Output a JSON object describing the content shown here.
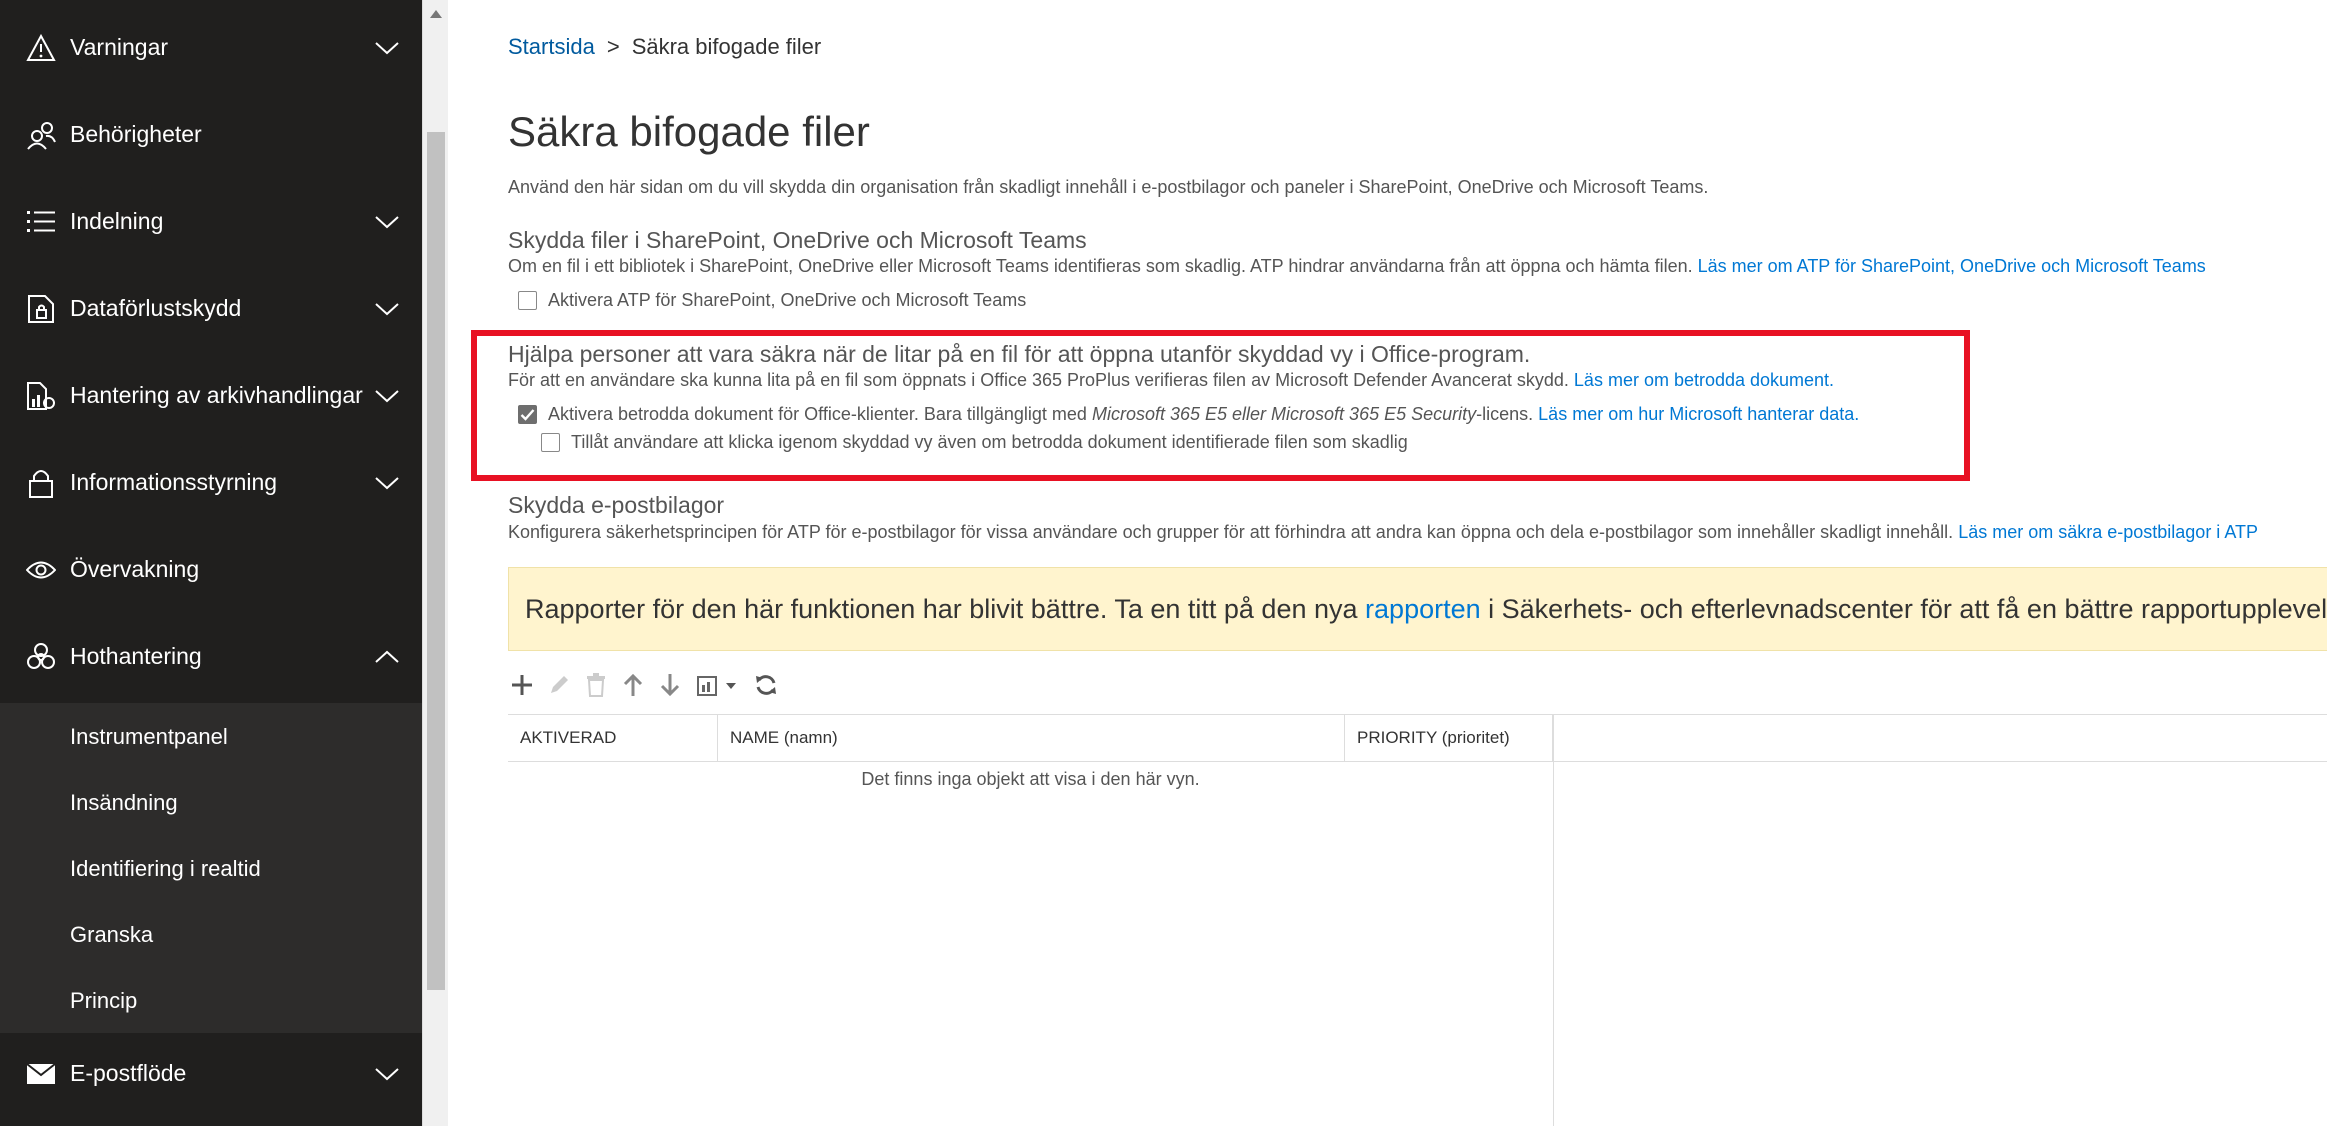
{
  "sidebar": {
    "items": [
      {
        "label": "Varningar",
        "icon": "warning-icon"
      },
      {
        "label": "Behörigheter",
        "icon": "permissions-icon"
      },
      {
        "label": "Indelning",
        "icon": "list-icon"
      },
      {
        "label": "Dataförlustskydd",
        "icon": "dlp-icon"
      },
      {
        "label": "Hantering av arkivhandlingar",
        "icon": "records-icon"
      },
      {
        "label": "Informationsstyrning",
        "icon": "lock-icon"
      },
      {
        "label": "Övervakning",
        "icon": "eye-icon"
      },
      {
        "label": "Hothantering",
        "icon": "biohazard-icon"
      },
      {
        "label": "E-postflöde",
        "icon": "mail-icon"
      }
    ],
    "subitems": [
      "Instrumentpanel",
      "Insändning",
      "Identifiering i realtid",
      "Granska",
      "Princip"
    ]
  },
  "breadcrumb": {
    "home": "Startsida",
    "separator": ">",
    "current": "Säkra bifogade filer"
  },
  "page": {
    "title": "Säkra bifogade filer",
    "description": "Använd den här sidan om du vill skydda din organisation från skadligt innehåll i e-postbilagor och paneler i SharePoint, OneDrive och Microsoft Teams."
  },
  "section1": {
    "title": "Skydda filer i SharePoint, OneDrive och Microsoft Teams",
    "desc": "Om en fil i ett bibliotek i SharePoint, OneDrive eller Microsoft Teams identifieras som skadlig. ATP hindrar användarna från att öppna och hämta filen.",
    "link": "Läs mer om ATP för SharePoint, OneDrive och Microsoft Teams",
    "checkbox": "Aktivera ATP för SharePoint, OneDrive och Microsoft Teams",
    "checkbox_checked": false
  },
  "section2": {
    "title": "Hjälpa personer att vara säkra när de litar på en fil för att öppna utanför skyddad vy i Office-program.",
    "desc": "För att en användare ska kunna lita på en fil som öppnats i Office 365 ProPlus verifieras filen av Microsoft Defender Avancerat skydd.",
    "link": "Läs mer om betrodda dokument.",
    "checkbox1_a": "Aktivera betrodda dokument för Office-klienter. Bara tillgängligt med",
    "checkbox1_italic": "Microsoft 365 E5 eller Microsoft 365 E5 Security",
    "checkbox1_b": "-licens.",
    "checkbox1_link": "Läs mer om hur Microsoft hanterar data.",
    "checkbox1_checked": true,
    "checkbox2": "Tillåt användare att klicka igenom skyddad vy även om betrodda dokument identifierade filen som skadlig",
    "checkbox2_checked": false
  },
  "section3": {
    "title": "Skydda e-postbilagor",
    "desc": "Konfigurera säkerhetsprincipen för ATP för e-postbilagor för vissa användare och grupper för att förhindra att andra kan öppna och dela e-postbilagor som innehåller skadligt innehåll.",
    "link": "Läs mer om säkra e-postbilagor i ATP"
  },
  "banner": {
    "text_a": "Rapporter för den här funktionen har blivit bättre. Ta en titt på den nya",
    "link": "rapporten",
    "text_b": "i Säkerhets- och efterlevnadscenter för att få en bättre rapportupplevelse."
  },
  "toolbar": [
    "add-icon",
    "edit-icon",
    "delete-icon",
    "move-up-icon",
    "move-down-icon",
    "export-icon",
    "refresh-icon"
  ],
  "table": {
    "columns": [
      "AKTIVERAD",
      "NAME (namn)",
      "PRIORITY (prioritet)"
    ],
    "empty": "Det finns inga objekt att visa i den här vyn."
  },
  "colors": {
    "sidebar": "#201f1e",
    "subnav": "#2d2c2b",
    "link": "#0078d4",
    "highlight": "#e81123",
    "banner": "#fff4ce"
  }
}
